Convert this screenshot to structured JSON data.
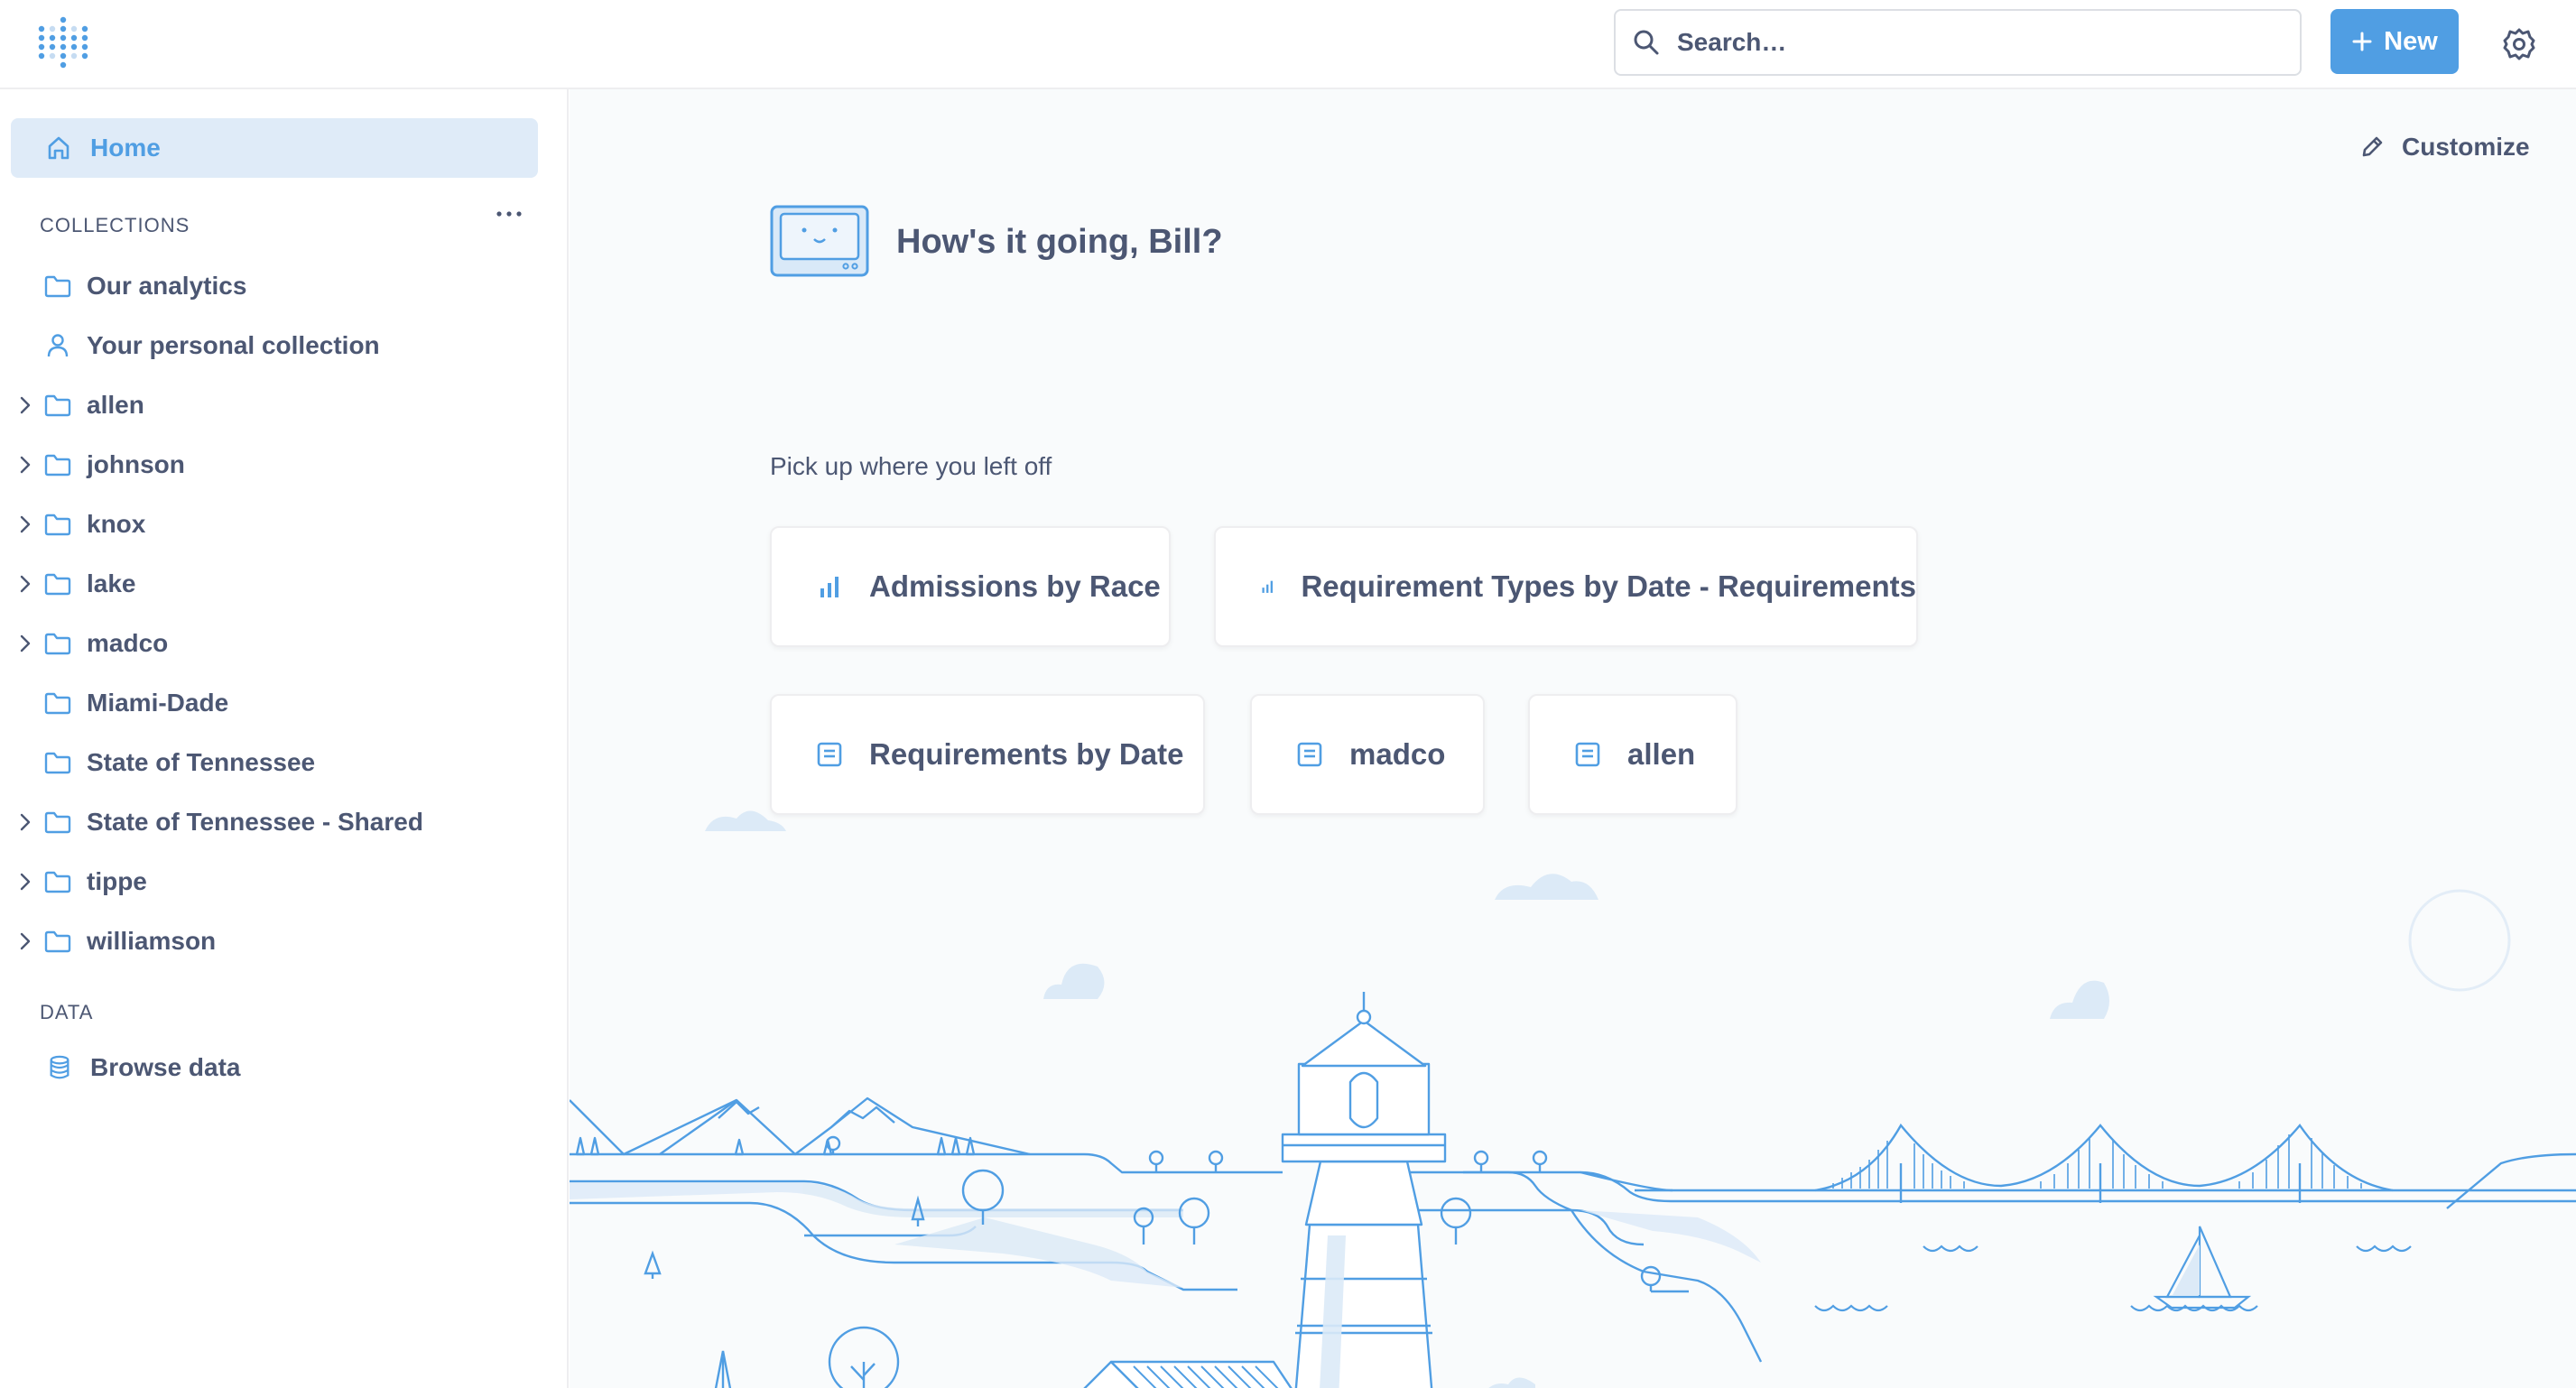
{
  "topbar": {
    "search": {
      "placeholder": "Search…"
    },
    "new_label": "New"
  },
  "sidebar": {
    "home_label": "Home",
    "collections_title": "COLLECTIONS",
    "collections": [
      {
        "label": "Our analytics",
        "icon": "folder-icon",
        "expandable": false
      },
      {
        "label": "Your personal collection",
        "icon": "person-icon",
        "expandable": false
      },
      {
        "label": "allen",
        "icon": "folder-icon",
        "expandable": true
      },
      {
        "label": "johnson",
        "icon": "folder-icon",
        "expandable": true
      },
      {
        "label": "knox",
        "icon": "folder-icon",
        "expandable": true
      },
      {
        "label": "lake",
        "icon": "folder-icon",
        "expandable": true
      },
      {
        "label": "madco",
        "icon": "folder-icon",
        "expandable": true
      },
      {
        "label": "Miami-Dade",
        "icon": "folder-icon",
        "expandable": false
      },
      {
        "label": "State of Tennessee",
        "icon": "folder-icon",
        "expandable": false
      },
      {
        "label": "State of Tennessee - Shared",
        "icon": "folder-icon",
        "expandable": true
      },
      {
        "label": "tippe",
        "icon": "folder-icon",
        "expandable": true
      },
      {
        "label": "williamson",
        "icon": "folder-icon",
        "expandable": true
      }
    ],
    "data_title": "DATA",
    "browse_data_label": "Browse data"
  },
  "main": {
    "customize_label": "Customize",
    "greeting": "How's it going, Bill?",
    "pickup_title": "Pick up where you left off",
    "recent_items": [
      {
        "title": "Admissions by Race",
        "icon": "bar-chart-icon"
      },
      {
        "title": "Requirement Types by Date - Requirements",
        "icon": "bar-chart-icon"
      },
      {
        "title": "Requirements by Date",
        "icon": "table-icon"
      },
      {
        "title": "madco",
        "icon": "table-icon"
      },
      {
        "title": "allen",
        "icon": "table-icon"
      }
    ]
  },
  "colors": {
    "brand": "#509ee3",
    "text": "#4c5773",
    "nav_active_bg": "#dfebf8",
    "main_bg": "#f9fbfc",
    "illustration": "#509ee3"
  }
}
